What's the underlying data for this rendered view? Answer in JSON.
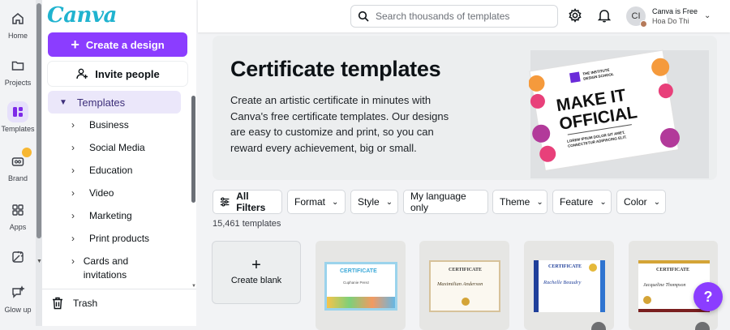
{
  "rail": {
    "items": [
      {
        "label": "Home",
        "icon": "home-icon"
      },
      {
        "label": "Projects",
        "icon": "folder-icon"
      },
      {
        "label": "Templates",
        "icon": "templates-icon"
      },
      {
        "label": "Brand",
        "icon": "brand-icon"
      },
      {
        "label": "Apps",
        "icon": "apps-icon"
      },
      {
        "label": "",
        "icon": "magic-icon"
      },
      {
        "label": "Glow up",
        "icon": "glow-up-icon"
      }
    ]
  },
  "panel": {
    "logo": "Canva",
    "create_label": "Create a design",
    "invite_label": "Invite people",
    "templates_label": "Templates",
    "sub_items": [
      {
        "label": "Business"
      },
      {
        "label": "Social Media"
      },
      {
        "label": "Education"
      },
      {
        "label": "Video"
      },
      {
        "label": "Marketing"
      },
      {
        "label": "Print products"
      },
      {
        "label": "Cards and invitations"
      }
    ],
    "trash_label": "Trash"
  },
  "topbar": {
    "search_placeholder": "Search thousands of templates",
    "account_plan": "Canva is Free",
    "account_name": "Hoa Do Thi",
    "avatar_initials": "CI"
  },
  "hero": {
    "title": "Certificate templates",
    "description": "Create an artistic certificate in minutes with Canva's free certificate templates. Our designs are easy to customize and print, so you can reward every achievement, big or small.",
    "image_text": {
      "brand": "THE INSTITUTE DESIGN SCHOOL",
      "headline_1": "MAKE IT",
      "headline_2": "OFFICIAL",
      "footer_1": "LOREM IPSUM DOLOR SIT AMET,",
      "footer_2": "CONSECTETUR ADIPISCING ELIT."
    }
  },
  "filters": {
    "all_filters": "All Filters",
    "chips": [
      {
        "label": "Format"
      },
      {
        "label": "Style"
      },
      {
        "label": "My language only"
      },
      {
        "label": "Theme"
      },
      {
        "label": "Feature"
      },
      {
        "label": "Color"
      }
    ]
  },
  "template_count": "15,461 templates",
  "cards": {
    "create_blank": "Create blank",
    "thumbs": [
      {
        "title": "CERTIFICATE",
        "name": "Cuphanie Perez",
        "accent": "#3aa8d8"
      },
      {
        "title": "CERTIFICATE",
        "name": "Maximilian Anderson",
        "accent": "#c9a86a"
      },
      {
        "title": "CERTIFICATE",
        "name": "Rachelle Beaudry",
        "accent": "#1f3f9a"
      },
      {
        "title": "CERTIFICATE",
        "name": "Jacqueline Thompson",
        "accent": "#d4a437"
      }
    ]
  },
  "help_label": "?",
  "colors": {
    "brand_purple": "#8b3dff",
    "logo_teal": "#20b3cf"
  }
}
